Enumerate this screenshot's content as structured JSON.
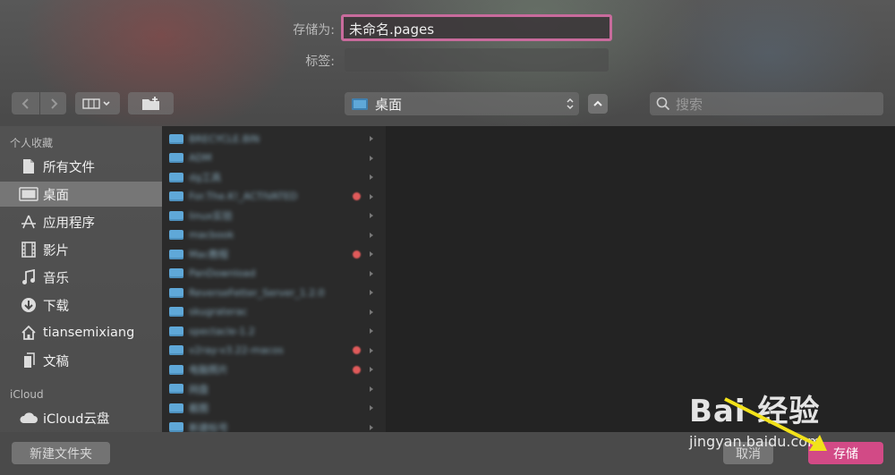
{
  "save_as_label": "存储为:",
  "filename_value": "未命名.pages",
  "tags_label": "标签:",
  "tags_value": "",
  "location_value": "桌面",
  "search_placeholder": "搜索",
  "sidebar": {
    "favorites_header": "个人收藏",
    "items": [
      {
        "label": "所有文件",
        "icon": "document-icon"
      },
      {
        "label": "桌面",
        "icon": "desktop-icon",
        "selected": true
      },
      {
        "label": "应用程序",
        "icon": "applications-icon"
      },
      {
        "label": "影片",
        "icon": "film-icon"
      },
      {
        "label": "音乐",
        "icon": "music-note-icon"
      },
      {
        "label": "下载",
        "icon": "download-icon"
      },
      {
        "label": "tiansemixiang",
        "icon": "home-icon"
      },
      {
        "label": "文稿",
        "icon": "documents-icon"
      }
    ],
    "icloud_header": "iCloud",
    "icloud_items": [
      {
        "label": "iCloud云盘",
        "icon": "cloud-icon"
      }
    ]
  },
  "files": [
    {
      "name": "BRECYCLE.BIN",
      "tag": false
    },
    {
      "name": "ADM",
      "tag": false
    },
    {
      "name": "dg工具",
      "tag": false
    },
    {
      "name": "For.The.K!_ACTIVATED",
      "tag": true
    },
    {
      "name": "linux实验",
      "tag": false
    },
    {
      "name": "macbook",
      "tag": false
    },
    {
      "name": "Mac教程",
      "tag": true
    },
    {
      "name": "PanDownload",
      "tag": false
    },
    {
      "name": "ReverseFetter_Server_1.2.0",
      "tag": false
    },
    {
      "name": "skugraterac",
      "tag": false
    },
    {
      "name": "spectacle-1.2",
      "tag": false
    },
    {
      "name": "v2ray-v3.22-macos",
      "tag": true
    },
    {
      "name": "电脑照片",
      "tag": true
    },
    {
      "name": "网盘",
      "tag": false
    },
    {
      "name": "截图",
      "tag": false
    },
    {
      "name": "新建标号",
      "tag": false
    }
  ],
  "new_folder_label": "新建文件夹",
  "cancel_label": "取消",
  "save_label": "存储",
  "watermark": {
    "brand": "Bai 经验",
    "url": "jingyan.baidu.com"
  },
  "colors": {
    "accent": "#d24a86",
    "focus_ring": "#c86b9c",
    "folder": "#5fa8d8",
    "tag": "#e05a5a"
  }
}
